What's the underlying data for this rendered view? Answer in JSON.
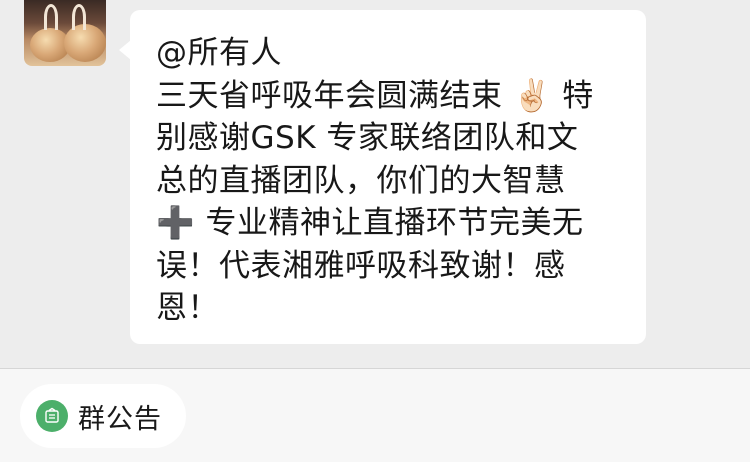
{
  "message": {
    "lines": [
      "@所有人",
      "三天省呼吸年会圆满结束 ✌🏻 特",
      "别感谢GSK 专家联络团队和文",
      "总的直播团队，你们的大智慧",
      "➕ 专业精神让直播环节完美无",
      "误！代表湘雅呼吸科致谢！感",
      "恩！"
    ]
  },
  "avatar_icon": "avatar-image",
  "bottom_bar": {
    "announcement_label": "群公告",
    "announcement_icon": "announcement-icon",
    "icon_color": "#4caf6a"
  },
  "colors": {
    "background": "#ededed",
    "bubble": "#ffffff",
    "bottom_bar": "#f7f7f7"
  }
}
